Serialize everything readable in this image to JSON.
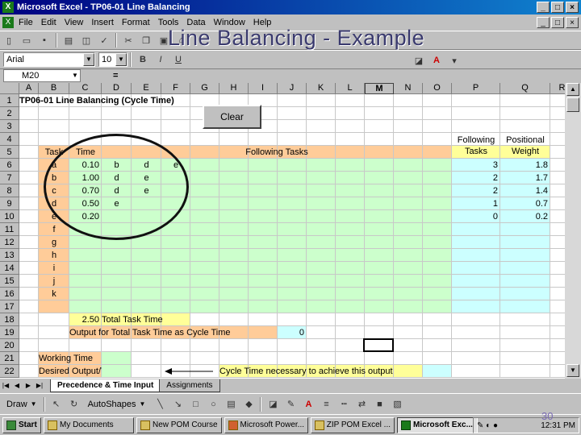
{
  "window": {
    "title": "Microsoft Excel - TP06-01 Line Balancing",
    "min": "_",
    "max": "□",
    "close": "×"
  },
  "slide_title": "Line Balancing - Example",
  "slide_number": "30",
  "menu": [
    "File",
    "Edit",
    "View",
    "Insert",
    "Format",
    "Tools",
    "Data",
    "Window",
    "Help"
  ],
  "format_bar": {
    "font": "Arial",
    "size": "10",
    "bold": "B",
    "italic": "I",
    "underline": "U"
  },
  "formula_bar": {
    "name_box": "M20",
    "eq": "="
  },
  "columns": [
    {
      "id": "A",
      "w": 24
    },
    {
      "id": "B",
      "w": 38
    },
    {
      "id": "C",
      "w": 40
    },
    {
      "id": "D",
      "w": 37
    },
    {
      "id": "E",
      "w": 37
    },
    {
      "id": "F",
      "w": 36
    },
    {
      "id": "G",
      "w": 36
    },
    {
      "id": "H",
      "w": 36
    },
    {
      "id": "I",
      "w": 36
    },
    {
      "id": "J",
      "w": 36
    },
    {
      "id": "K",
      "w": 36
    },
    {
      "id": "L",
      "w": 36
    },
    {
      "id": "M",
      "w": 36
    },
    {
      "id": "N",
      "w": 36
    },
    {
      "id": "O",
      "w": 36
    },
    {
      "id": "P",
      "w": 60
    },
    {
      "id": "Q",
      "w": 62
    },
    {
      "id": "R",
      "w": 30
    }
  ],
  "rows": [
    "1",
    "2",
    "3",
    "4",
    "5",
    "6",
    "7",
    "8",
    "9",
    "10",
    "11",
    "12",
    "13",
    "14",
    "15",
    "16",
    "17",
    "18",
    "19",
    "20",
    "21",
    "22"
  ],
  "sheet": {
    "title": "TP06-01 Line Balancing (Cycle Time)",
    "clear_button": "Clear",
    "headers": {
      "task": "Task",
      "time": "Time",
      "following": "Following Tasks",
      "following_count": [
        "Following",
        "Tasks"
      ],
      "positional": [
        "Positional",
        "Weight"
      ]
    },
    "tasks": [
      {
        "task": "a",
        "time": "0.10",
        "follow": [
          "b",
          "d",
          "e"
        ],
        "count": "3",
        "weight": "1.8"
      },
      {
        "task": "b",
        "time": "1.00",
        "follow": [
          "d",
          "e"
        ],
        "count": "2",
        "weight": "1.7"
      },
      {
        "task": "c",
        "time": "0.70",
        "follow": [
          "d",
          "e"
        ],
        "count": "2",
        "weight": "1.4"
      },
      {
        "task": "d",
        "time": "0.50",
        "follow": [
          "e"
        ],
        "count": "1",
        "weight": "0.7"
      },
      {
        "task": "e",
        "time": "0.20",
        "follow": [],
        "count": "0",
        "weight": "0.2"
      },
      {
        "task": "f",
        "time": "",
        "follow": [],
        "count": "",
        "weight": ""
      },
      {
        "task": "g",
        "time": "",
        "follow": [],
        "count": "",
        "weight": ""
      },
      {
        "task": "h",
        "time": "",
        "follow": [],
        "count": "",
        "weight": ""
      },
      {
        "task": "i",
        "time": "",
        "follow": [],
        "count": "",
        "weight": ""
      },
      {
        "task": "j",
        "time": "",
        "follow": [],
        "count": "",
        "weight": ""
      },
      {
        "task": "k",
        "time": "",
        "follow": [],
        "count": "",
        "weight": ""
      }
    ],
    "total_time": "2.50",
    "total_label": "Total Task Time",
    "output_label": "Output for Total Task Time as Cycle Time",
    "output_value": "0",
    "working_time": "Working Time",
    "desired_output": "Desired Output/Time",
    "cycle_note": "Cycle Time necessary to achieve this output"
  },
  "tabs": {
    "active": "Precedence & Time Input",
    "other": "Assignments"
  },
  "drawbar": {
    "draw": "Draw",
    "autoshapes": "AutoShapes"
  },
  "taskbar": {
    "start": "Start",
    "items": [
      "My Documents",
      "New POM Course",
      "Microsoft Power...",
      "ZIP POM Excel ...",
      "Microsoft Exc..."
    ],
    "active_index": 4,
    "clock": "12:31 PM"
  },
  "colors": {
    "orange": "#ffcc99",
    "green": "#ccffcc",
    "yellow": "#ffff99",
    "cyan": "#ccffff",
    "title_bar": "#000080"
  }
}
